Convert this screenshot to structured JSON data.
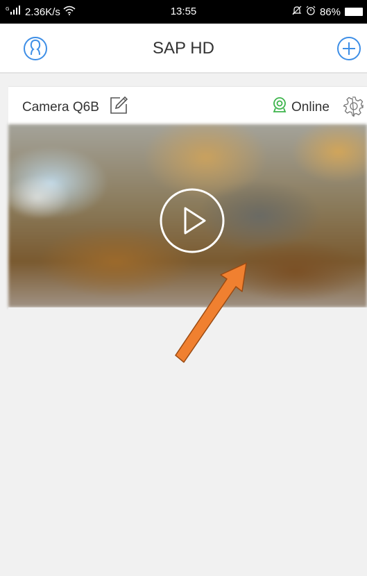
{
  "status_bar": {
    "network": "2.36K/s",
    "time": "13:55",
    "battery": "86%"
  },
  "header": {
    "title": "SAP HD",
    "left_icon": "user-icon",
    "right_icon": "add-icon"
  },
  "camera": {
    "name": "Camera Q6B",
    "status": "Online",
    "status_color": "#3cb44b",
    "edit_icon": "edit-icon",
    "settings_icon": "gear-icon",
    "play_icon": "play-icon"
  },
  "annotation": {
    "arrow_color": "#f08030"
  }
}
